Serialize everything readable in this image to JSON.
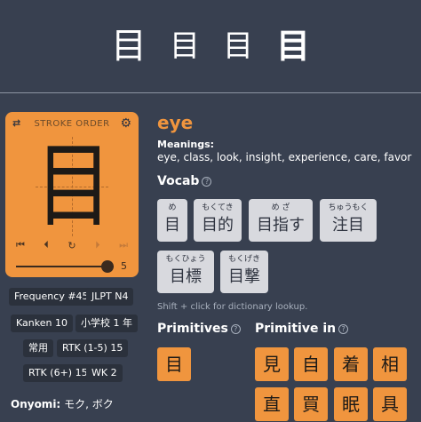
{
  "hero": {
    "glyphs": [
      "目",
      "目",
      "目",
      "目"
    ]
  },
  "stroke_order": {
    "title": "STROKE ORDER",
    "kanji": "目",
    "icons": {
      "left": "reset-icon",
      "right": "gear-icon"
    },
    "controls": [
      "⏮",
      "⏴",
      "↻",
      "⏵",
      "⏭"
    ],
    "slider_value_fraction": 0.9,
    "stroke_count": "5"
  },
  "tags": [
    "Frequency #45",
    "JLPT N4",
    "Kanken 10",
    "小学校 1 年",
    "常用",
    "RTK (1-5) 15",
    "RTK (6+) 15",
    "WK 2"
  ],
  "onyomi": {
    "label": "Onyomi:",
    "value": "モク, ボク"
  },
  "keyword": "eye",
  "meanings": {
    "label": "Meanings:",
    "value": "eye, class, look, insight, experience, care, favor"
  },
  "vocab": {
    "title": "Vocab",
    "items": [
      {
        "furigana": "め",
        "word": "目"
      },
      {
        "furigana": "もくてき",
        "word": "目的"
      },
      {
        "furigana": "め  ざ",
        "word": "目指す"
      },
      {
        "furigana": "ちゅうもく",
        "word": "注目"
      },
      {
        "furigana": "もくひょう",
        "word": "目標"
      },
      {
        "furigana": "もくげき",
        "word": "目撃"
      }
    ],
    "hint": "Shift + click for dictionary lookup."
  },
  "primitives": {
    "title": "Primitives",
    "items": [
      "目"
    ]
  },
  "primitive_in": {
    "title": "Primitive in",
    "items": [
      "見",
      "自",
      "着",
      "相",
      "直",
      "買",
      "眠",
      "具"
    ]
  },
  "colors": {
    "accent": "#f0953e",
    "background": "#384050",
    "tag_bg": "#2b313c",
    "vocab_bg": "#d8d9de"
  }
}
